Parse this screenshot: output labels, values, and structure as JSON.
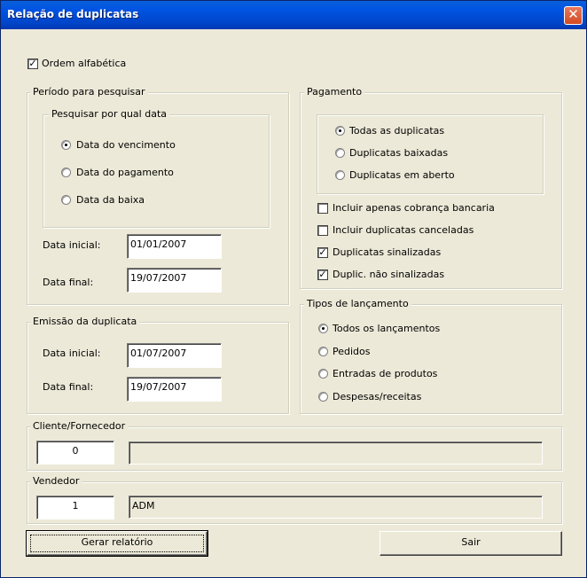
{
  "window": {
    "title": "Relação de duplicatas",
    "close_label": "✕"
  },
  "ordem": {
    "label": "Ordem alfabética",
    "checked": true,
    "check_mark": "✓"
  },
  "periodo": {
    "title": "Período para pesquisar",
    "sub_title": "Pesquisar por qual data",
    "options": [
      "Data do vencimento",
      "Data do pagamento",
      "Data da baixa"
    ],
    "selected": 0,
    "data_inicial_label": "Data inicial:",
    "data_inicial": "01/01/2007",
    "data_final_label": "Data final:",
    "data_final": "19/07/2007"
  },
  "emissao": {
    "title": "Emissão da duplicata",
    "data_inicial_label": "Data inicial:",
    "data_inicial": "01/07/2007",
    "data_final_label": "Data final:",
    "data_final": "19/07/2007"
  },
  "pagamento": {
    "title": "Pagamento",
    "options": [
      "Todas as duplicatas",
      "Duplicatas baixadas",
      "Duplicatas em aberto"
    ],
    "selected": 0,
    "checks": [
      {
        "label": "Incluir apenas cobrança bancaria",
        "checked": false
      },
      {
        "label": "Incluir duplicatas canceladas",
        "checked": false
      },
      {
        "label": "Duplicatas sinalizadas",
        "checked": true
      },
      {
        "label": "Duplic. não sinalizadas",
        "checked": true
      }
    ]
  },
  "tipos": {
    "title": "Tipos de lançamento",
    "options": [
      "Todos os lançamentos",
      "Pedidos",
      "Entradas de produtos",
      "Despesas/receitas"
    ],
    "selected": 0
  },
  "cliente": {
    "title": "Cliente/Fornecedor",
    "code": "0",
    "name": ""
  },
  "vendedor": {
    "title": "Vendedor",
    "code": "1",
    "name": "ADM"
  },
  "buttons": {
    "gerar": "Gerar relatório",
    "sair": "Sair"
  }
}
